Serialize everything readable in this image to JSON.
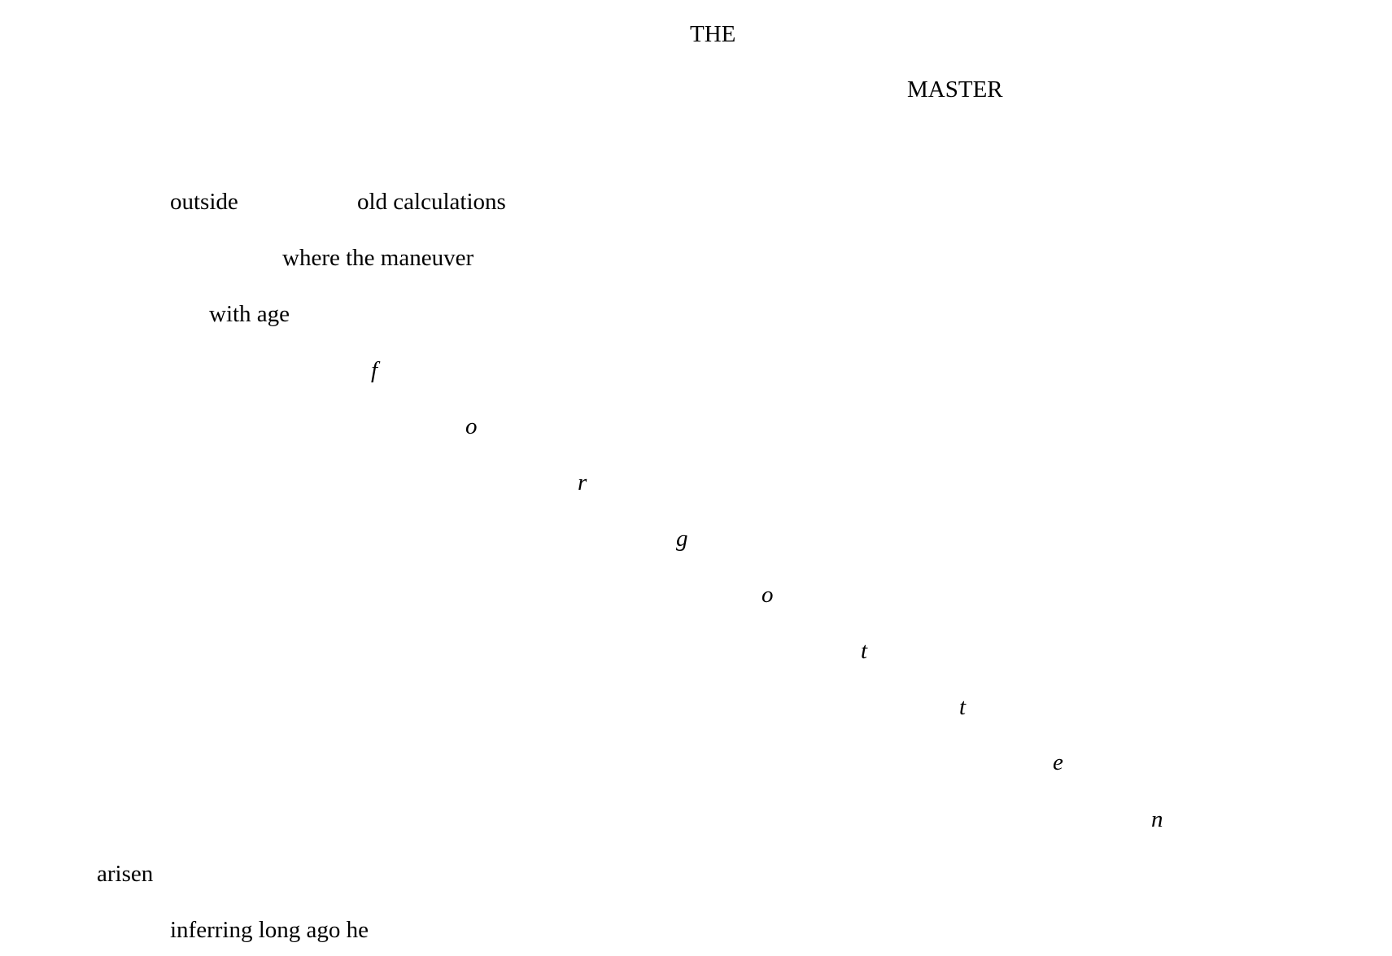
{
  "poem": {
    "title_line1": "THE",
    "title_line2": "MASTER",
    "lines": [
      "outside",
      "old calculations",
      "where the maneuver",
      "with age"
    ],
    "cascade_letters": [
      "f",
      "o",
      "r",
      "g",
      "o",
      "t",
      "t",
      "e",
      "n"
    ],
    "closing": [
      "arisen",
      "inferring long ago he"
    ]
  }
}
